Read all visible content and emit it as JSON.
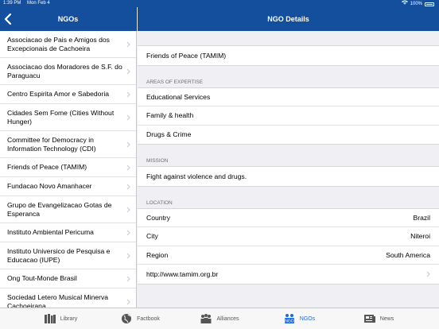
{
  "status": {
    "time": "1:39 PM",
    "date": "Mon Feb 4",
    "battery": "100%"
  },
  "master": {
    "title": "NGOs",
    "items": [
      {
        "label": "Associacao de Pais e Amigos dos Excepcionais de Cachoeira"
      },
      {
        "label": "Associacao dos Moradores de S.F. do Paraguacu"
      },
      {
        "label": "Centro Espirita Amor e Sabedoria"
      },
      {
        "label": "Cidades Sem Fome (Cities Without Hunger)"
      },
      {
        "label": "Committee for Democracy in Information Technology (CDI)"
      },
      {
        "label": "Friends of Peace (TAMIM)"
      },
      {
        "label": "Fundacao Novo Amanhacer"
      },
      {
        "label": "Grupo de Evangelizacao Gotas de Esperanca"
      },
      {
        "label": "Instituto Ambiental Pericuma"
      },
      {
        "label": "Instituto Universico de Pesquisa e Educacao  (IUPE)"
      },
      {
        "label": "Ong Tout-Monde Brasil"
      },
      {
        "label": "Sociedad Letero Musical Minerva Cachoeirana"
      }
    ]
  },
  "detail": {
    "title": "NGO Details",
    "name": "Friends of Peace (TAMIM)",
    "expertise_header": "AREAS OF EXPERTISE",
    "expertise": [
      "Educational Services",
      "Family & health",
      "Drugs & Crime"
    ],
    "mission_header": "MISSION",
    "mission": "Fight against violence and drugs.",
    "location_header": "LOCATION",
    "country_label": "Country",
    "country": "Brazil",
    "city_label": "City",
    "city": "Niteroi",
    "region_label": "Region",
    "region": "South America",
    "url": "http://www.tamim.org.br"
  },
  "tabs": [
    {
      "label": "Library",
      "icon": "books-icon"
    },
    {
      "label": "Factbook",
      "icon": "globe-icon"
    },
    {
      "label": "Alliances",
      "icon": "people-icon"
    },
    {
      "label": "NGOs",
      "icon": "ngo-icon",
      "active": true
    },
    {
      "label": "News",
      "icon": "news-icon"
    }
  ],
  "colors": {
    "nav": "#134f9c",
    "active_tab": "#1a6be0"
  }
}
